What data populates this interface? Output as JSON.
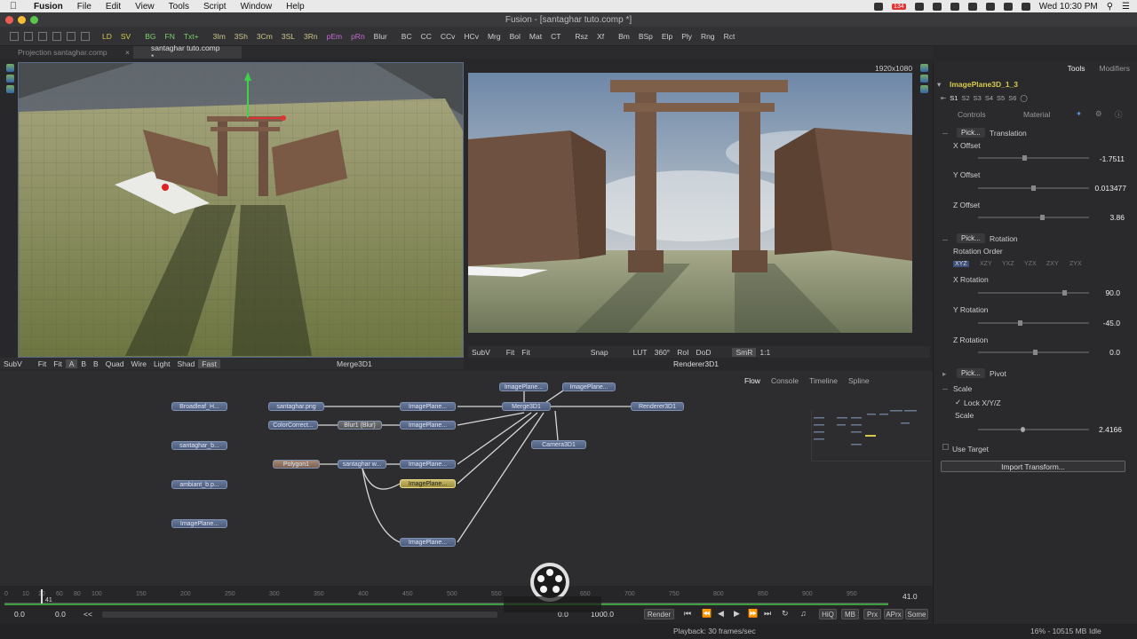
{
  "menubar": {
    "app": "Fusion",
    "items": [
      "File",
      "Edit",
      "View",
      "Tools",
      "Script",
      "Window",
      "Help"
    ],
    "badge": "134",
    "clock": "Wed 10:30 PM"
  },
  "window": {
    "title": "Fusion - [santaghar tuto.comp *]"
  },
  "toolbar": {
    "buttons": [
      "LD",
      "SV",
      "BG",
      "FN",
      "Txt+",
      "3Im",
      "3Sh",
      "3Cm",
      "3SL",
      "3Rn",
      "pEm",
      "pRn",
      "Blur",
      "BC",
      "CC",
      "CCv",
      "HCv",
      "Mrg",
      "Bol",
      "Mat",
      "CT",
      "Rsz",
      "Xf",
      "Bm",
      "BSp",
      "Elp",
      "Ply",
      "Rng",
      "Rct"
    ]
  },
  "tabs": [
    {
      "label": "Projection santaghar.comp"
    },
    {
      "label": "santaghar tuto.comp *"
    }
  ],
  "viewer_left": {
    "bar": [
      "SubV",
      "Fit",
      "Fit",
      "A",
      "B",
      "B",
      "Quad",
      "Wire",
      "Light",
      "Shad",
      "Fast"
    ],
    "title": "Merge3D1"
  },
  "viewer_right": {
    "resolution": "1920x1080",
    "bar": [
      "SubV",
      "Fit",
      "Fit",
      "Snap",
      "LUT",
      "360°",
      "RoI",
      "DoD",
      "SmR",
      "1:1"
    ],
    "title": "Renderer3D1"
  },
  "flow": {
    "tabs": [
      "Flow",
      "Console",
      "Timeline",
      "Spline"
    ],
    "nodes": {
      "broadleaf": "Broadleaf_H...",
      "santaghar_b": "santaghar_b...",
      "ambiant": "ambiant_b.p...",
      "imageplane_left": "ImagePlane...",
      "santaghar_png": "santaghar.png",
      "colorcorrect": "ColorCorrect...",
      "blur1": "Blur1 (Blur)",
      "polygon1": "Polygon1",
      "santaghar_w": "santaghar w...",
      "ip_a": "ImagePlane...",
      "ip_b": "ImagePlane...",
      "ip_c": "ImagePlane...",
      "ip_d": "ImagePlane...",
      "ip_e": "ImagePlane...",
      "ip_top1": "ImagePlane...",
      "ip_top2": "ImagePlane...",
      "merge3d": "Merge3D1",
      "camera3d": "Camera3D1",
      "renderer3d": "Renderer3D1"
    }
  },
  "timeline": {
    "ticks": [
      "0",
      "10",
      "20",
      "41",
      "60",
      "80",
      "100",
      "150",
      "200",
      "250",
      "300",
      "350",
      "400",
      "450",
      "500",
      "550",
      "600",
      "650",
      "700",
      "750",
      "800",
      "850",
      "900",
      "950"
    ],
    "current_frame": "41",
    "end_value": "41.0",
    "start": "0.0",
    "render_start": "0.0",
    "render_end": "1000.0",
    "current_time": "0.0",
    "rewind": "<<",
    "render_label": "Render",
    "buttons": [
      "HiQ",
      "MB",
      "Prx",
      "APrx",
      "Some"
    ]
  },
  "inspector": {
    "tabs": [
      "Tools",
      "Modifiers"
    ],
    "node_name": "ImagePlane3D_1_3",
    "scene_tabs": [
      "S1",
      "S2",
      "S3",
      "S4",
      "S5",
      "S6"
    ],
    "sub_tabs": [
      "Controls",
      "Material"
    ],
    "pick": "Pick...",
    "translation": "Translation",
    "x_offset_label": "X Offset",
    "x_offset": "-1.7511",
    "y_offset_label": "Y Offset",
    "y_offset": "0.013477",
    "z_offset_label": "Z Offset",
    "z_offset": "3.86",
    "rotation": "Rotation",
    "rotation_order_label": "Rotation Order",
    "rotation_orders": [
      "XYZ",
      "XZY",
      "YXZ",
      "YZX",
      "ZXY",
      "ZYX"
    ],
    "x_rotation_label": "X Rotation",
    "x_rotation": "90.0",
    "y_rotation_label": "Y Rotation",
    "y_rotation": "-45.0",
    "z_rotation_label": "Z Rotation",
    "z_rotation": "0.0",
    "pivot": "Pivot",
    "scale_section": "Scale",
    "lock_label": "Lock X/Y/Z",
    "scale_label": "Scale",
    "scale_value": "2.4166",
    "use_target": "Use Target",
    "import_button": "Import Transform..."
  },
  "status": {
    "playback": "Playback: 30 frames/sec",
    "memory": "16% - 10515 MB",
    "state": "Idle"
  },
  "colors": {
    "accent": "#3e9d3e",
    "selected_node": "#c9bb6a",
    "node": "#5a6b8c"
  }
}
